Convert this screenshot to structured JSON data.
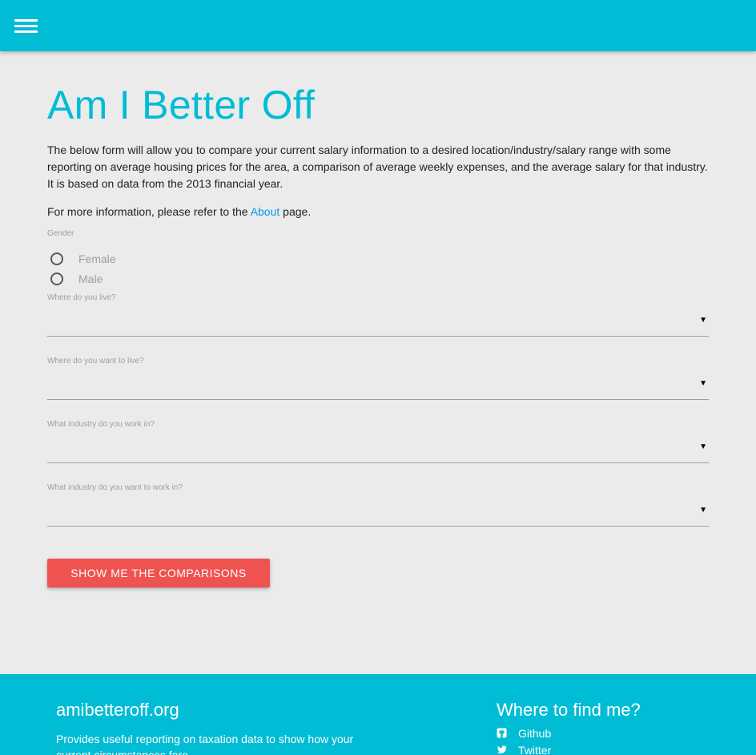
{
  "header": {
    "menu_icon": "hamburger-menu-icon",
    "bg_color": "#00bcd4"
  },
  "main": {
    "title": "Am I Better Off",
    "intro": "The below form will allow you to compare your current salary information to a desired location/industry/salary range with some reporting on average housing prices for the area, a comparison of average weekly expenses, and the average salary for that industry. It is based on data from the 2013 financial year.",
    "more_info_prefix": "For more information, please refer to the ",
    "more_info_link": "About",
    "more_info_suffix": " page."
  },
  "form": {
    "gender_label": "Gender",
    "gender_options": [
      "Female",
      "Male"
    ],
    "selects": [
      {
        "label": "Where do you live?",
        "value": ""
      },
      {
        "label": "Where do you want to live?",
        "value": ""
      },
      {
        "label": "What industry do you work in?",
        "value": ""
      },
      {
        "label": "What industry do you want to work in?",
        "value": ""
      }
    ],
    "submit_label": "Show me the comparisons",
    "submit_color": "#ef5350"
  },
  "footer": {
    "brand": "amibetteroff.org",
    "description": "Provides useful reporting on taxation data to show how your current circumstances fare.",
    "find_title": "Where to find me?",
    "links": [
      {
        "label": "Github",
        "icon": "github-icon"
      },
      {
        "label": "Twitter",
        "icon": "twitter-icon"
      }
    ]
  }
}
